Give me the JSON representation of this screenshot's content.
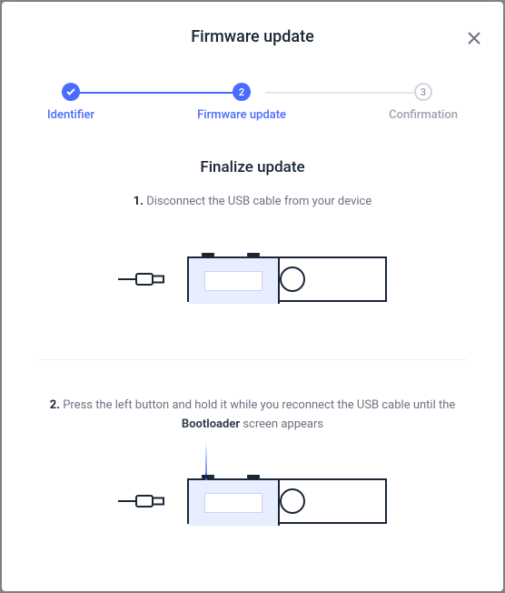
{
  "header": {
    "title": "Firmware update"
  },
  "stepper": {
    "steps": [
      {
        "label": "Identifier",
        "state": "done"
      },
      {
        "label": "Firmware update",
        "state": "active",
        "num": "2"
      },
      {
        "label": "Confirmation",
        "state": "pending",
        "num": "3"
      }
    ]
  },
  "content": {
    "subtitle": "Finalize update",
    "step1": {
      "num": "1.",
      "text": "Disconnect the USB cable from your device"
    },
    "step2": {
      "num": "2.",
      "text_a": "Press the left button and hold it while you reconnect the USB cable until the ",
      "bold": "Bootloader",
      "text_b": " screen appears"
    }
  }
}
